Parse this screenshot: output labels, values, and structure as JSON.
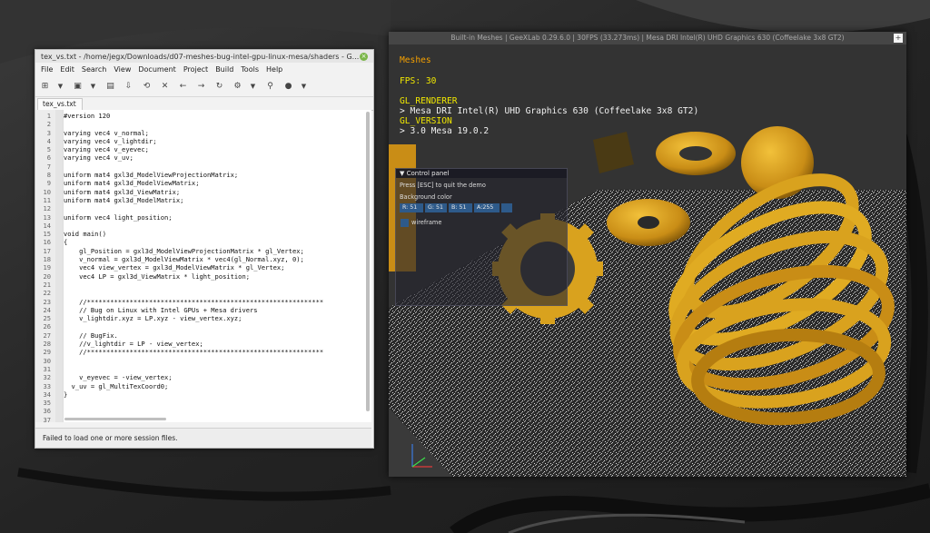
{
  "editor": {
    "title": "tex_vs.txt - /home/jegx/Downloads/d07-meshes-bug-intel-gpu-linux-mesa/shaders - G...",
    "menu": [
      "File",
      "Edit",
      "Search",
      "View",
      "Document",
      "Project",
      "Build",
      "Tools",
      "Help"
    ],
    "tab_label": "tex_vs.txt",
    "status": "Failed to load one or more session files.",
    "lines": [
      "#version 120",
      "",
      "varying vec4 v_normal;",
      "varying vec4 v_lightdir;",
      "varying vec4 v_eyevec;",
      "varying vec4 v_uv;",
      "",
      "uniform mat4 gxl3d_ModelViewProjectionMatrix;",
      "uniform mat4 gxl3d_ModelViewMatrix;",
      "uniform mat4 gxl3d_ViewMatrix;",
      "uniform mat4 gxl3d_ModelMatrix;",
      "",
      "uniform vec4 light_position;",
      "",
      "void main()",
      "{",
      "    gl_Position = gxl3d_ModelViewProjectionMatrix * gl_Vertex;",
      "    v_normal = gxl3d_ModelViewMatrix * vec4(gl_Normal.xyz, 0);",
      "    vec4 view_vertex = gxl3d_ModelViewMatrix * gl_Vertex;",
      "    vec4 LP = gxl3d_ViewMatrix * light_position;",
      "",
      "",
      "    //*************************************************************",
      "    // Bug on Linux with Intel GPUs + Mesa drivers",
      "    v_lightdir.xyz = LP.xyz - view_vertex.xyz;",
      "",
      "    // BugFix.",
      "    //v_lightdir = LP - view_vertex;",
      "    //*************************************************************",
      "",
      "",
      "    v_eyevec = -view_vertex;",
      "  v_uv = gl_MultiTexCoord0;",
      "}",
      "",
      "",
      ""
    ]
  },
  "geexlab": {
    "title": "Built-in Meshes | GeeXLab 0.29.6.0 | 30FPS (33.273ms) | Mesa DRI Intel(R) UHD Graphics 630 (Coffeelake 3x8 GT2)",
    "hud_title": "Meshes",
    "fps": "FPS: 30",
    "renderer_label": "GL_RENDERER",
    "renderer_value": "> Mesa DRI Intel(R) UHD Graphics 630 (Coffeelake 3x8 GT2)",
    "version_label": "GL_VERSION",
    "version_value": "> 3.0 Mesa 19.0.2",
    "control_panel": {
      "header": "Control panel",
      "hint": "Press [ESC] to quit the demo",
      "bg_label": "Background color",
      "r": "R: 51",
      "g": "G: 51",
      "b": "B: 51",
      "a": "A:255",
      "wireframe": "wireframe"
    }
  },
  "colors": {
    "hud_orange": "#f5a000",
    "hud_yellow": "#f1e800",
    "widget_blue": "#2e5a8a",
    "mesh_gold": "#d9a21e"
  }
}
